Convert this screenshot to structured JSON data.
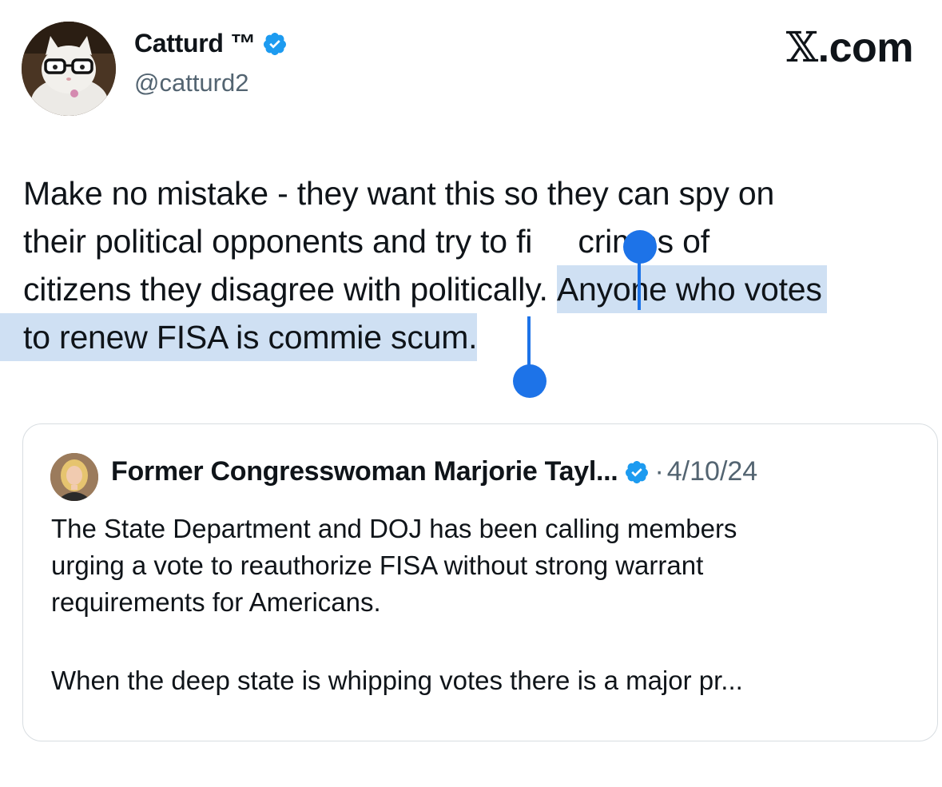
{
  "author": {
    "name": "Catturd ™",
    "handle": "@catturd2",
    "verified": true,
    "avatar_icon": "cat-with-glasses-avatar"
  },
  "brand": {
    "glyph": "𝕏",
    "suffix": ".com"
  },
  "tweet": {
    "lines": [
      "Make no mistake - they want this so they can spy on",
      "their political opponents and try to fi",
      "citizens they disagree with politically. ",
      "to renew FISA is commie scum."
    ],
    "line2_tail": " crimes of",
    "selected_part1": "Anyone who votes",
    "selected_part2": "to renew FISA is commie scum."
  },
  "quote": {
    "author_name": "Former Congresswoman Marjorie Tayl...",
    "separator": "·",
    "date": "4/10/24",
    "verified": true,
    "avatar_icon": "woman-portrait-avatar",
    "lines": [
      "The State Department and DOJ has been calling members",
      "urging a vote to reauthorize FISA without strong warrant",
      "requirements for Americans.",
      "When the deep state is whipping votes there is a major pr..."
    ]
  },
  "colors": {
    "selection": "#cfe0f3",
    "selection_handle": "#1d73e8",
    "verified_badge": "#1d9bf0",
    "secondary_text": "#536471"
  }
}
